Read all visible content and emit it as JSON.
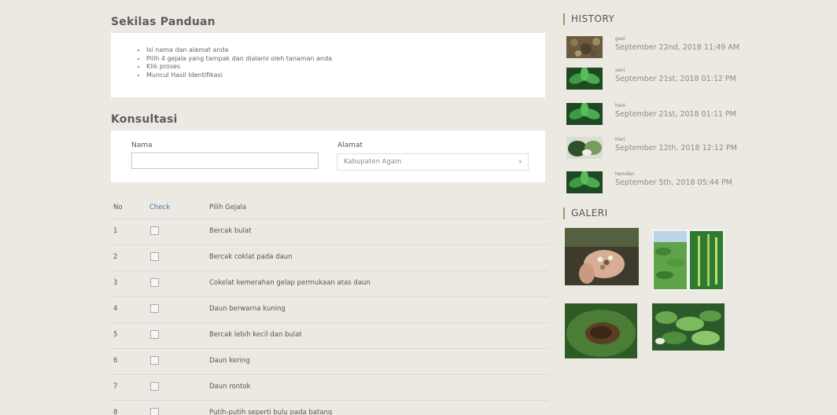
{
  "panduan": {
    "title": "Sekilas Panduan",
    "items": [
      "Isi nama dan alamat anda",
      "Pilih 4 gejala yang tampak dan dialami oleh tanaman anda",
      "Klik proses",
      "Muncul Hasil Identifikasi"
    ]
  },
  "konsultasi": {
    "title": "Konsultasi",
    "nama_label": "Nama",
    "nama_value": "",
    "alamat_label": "Alamat",
    "alamat_selected": "Kabupaten Agam"
  },
  "table": {
    "headers": {
      "no": "No",
      "check": "Check",
      "gejala": "Pilih Gejala"
    },
    "rows": [
      {
        "no": "1",
        "gejala": "Bercak bulat"
      },
      {
        "no": "2",
        "gejala": "Bercak coklat pada daun"
      },
      {
        "no": "3",
        "gejala": "Cokelat kemerahan gelap permukaan atas daun"
      },
      {
        "no": "4",
        "gejala": "Daun berwarna kuning"
      },
      {
        "no": "5",
        "gejala": "Bercak lebih kecil dan bulat"
      },
      {
        "no": "6",
        "gejala": "Daun kering"
      },
      {
        "no": "7",
        "gejala": "Daun rontok"
      },
      {
        "no": "8",
        "gejala": "Putih-putih seperti bulu pada batang"
      }
    ]
  },
  "history": {
    "title": "HISTORY",
    "items": [
      {
        "name": "gani",
        "date": "September 22nd, 2018 11:49 AM"
      },
      {
        "name": "sani",
        "date": "September 21st, 2018 01:12 PM"
      },
      {
        "name": "hani",
        "date": "September 21st, 2018 01:11 PM"
      },
      {
        "name": "Hari",
        "date": "September 12th, 2018 12:12 PM"
      },
      {
        "name": "hamdan",
        "date": "September 5th, 2018 05:44 PM"
      }
    ]
  },
  "galeri": {
    "title": "GALERI"
  },
  "colors": {
    "accent_link": "#3d7fb0",
    "section_bar": "#8aa66b",
    "background": "#ece9e3"
  }
}
